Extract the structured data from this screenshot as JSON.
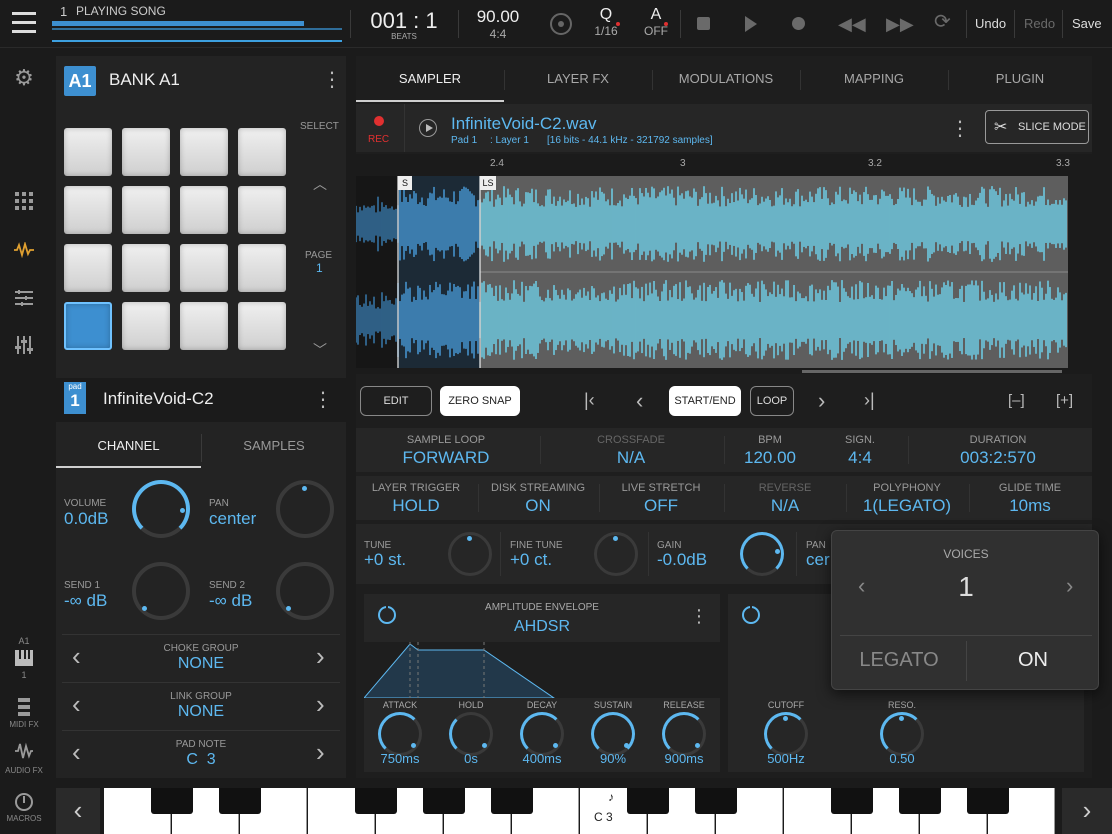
{
  "topbar": {
    "song_number": "1",
    "song_label": "PLAYING SONG",
    "position": "001 : 1",
    "position_unit": "BEATS",
    "tempo": "90.00",
    "signature": "4:4",
    "quantize_label": "Q",
    "quantize_value": "1/16",
    "auto_label": "A",
    "auto_value": "OFF",
    "undo": "Undo",
    "redo": "Redo",
    "save": "Save"
  },
  "leftnav": {
    "bank_small": "A1",
    "bank_small_num": "1",
    "midi_fx": "MIDI FX",
    "audio_fx": "AUDIO FX",
    "macros": "MACROS"
  },
  "bank": {
    "badge": "A1",
    "title": "BANK A1",
    "select_label": "SELECT",
    "page_label": "PAGE",
    "page_value": "1",
    "selected_pad_index": 12
  },
  "pad": {
    "badge_label": "pad",
    "badge_num": "1",
    "name": "InfiniteVoid-C2"
  },
  "pad_tabs": [
    "CHANNEL",
    "SAMPLES"
  ],
  "channel": {
    "volume_label": "VOLUME",
    "volume_value": "0.0dB",
    "pan_label": "PAN",
    "pan_value": "center",
    "send1_label": "SEND 1",
    "send1_value": "-∞ dB",
    "send2_label": "SEND 2",
    "send2_value": "-∞ dB",
    "choke_label": "CHOKE GROUP",
    "choke_value": "NONE",
    "link_label": "LINK GROUP",
    "link_value": "NONE",
    "note_label": "PAD NOTE",
    "note_value": "C  3"
  },
  "main_tabs": [
    "SAMPLER",
    "LAYER FX",
    "MODULATIONS",
    "MAPPING",
    "PLUGIN"
  ],
  "sample": {
    "rec_label": "REC",
    "filename": "InfiniteVoid-C2.wav",
    "pad_ref": "Pad 1",
    "layer_ref": ": Layer 1",
    "info": "[16 bits - 44.1 kHz - 321792 samples]",
    "slice_mode": "SLICE MODE",
    "ruler": [
      "2.4",
      "3",
      "3.2",
      "3.3"
    ],
    "marker_s": "S",
    "marker_ls": "LS"
  },
  "editbar": {
    "edit": "EDIT",
    "zero_snap": "ZERO SNAP",
    "start_end": "START/END",
    "loop": "LOOP",
    "zoom_out": "[–]",
    "zoom_in": "[+]"
  },
  "params1": [
    {
      "label": "SAMPLE LOOP",
      "value": "FORWARD"
    },
    {
      "label": "CROSSFADE",
      "value": "N/A"
    },
    {
      "label": "BPM",
      "value": "120.00"
    },
    {
      "label": "SIGN.",
      "value": "4:4"
    },
    {
      "label": "DURATION",
      "value": "003:2:570"
    }
  ],
  "params2": [
    {
      "label": "LAYER TRIGGER",
      "value": "HOLD"
    },
    {
      "label": "DISK STREAMING",
      "value": "ON"
    },
    {
      "label": "LIVE STRETCH",
      "value": "OFF"
    },
    {
      "label": "REVERSE",
      "value": "N/A"
    },
    {
      "label": "POLYPHONY",
      "value": "1(LEGATO)"
    },
    {
      "label": "GLIDE TIME",
      "value": "10ms"
    }
  ],
  "tuning": [
    {
      "label": "TUNE",
      "value": "+0 st."
    },
    {
      "label": "FINE TUNE",
      "value": "+0 ct."
    },
    {
      "label": "GAIN",
      "value": "-0.0dB"
    },
    {
      "label": "PAN",
      "value": "cer"
    }
  ],
  "envelope": {
    "title": "AMPLITUDE ENVELOPE",
    "type": "AHDSR",
    "knobs": [
      {
        "label": "ATTACK",
        "value": "750ms"
      },
      {
        "label": "HOLD",
        "value": "0s"
      },
      {
        "label": "DECAY",
        "value": "400ms"
      },
      {
        "label": "SUSTAIN",
        "value": "90%"
      },
      {
        "label": "RELEASE",
        "value": "900ms"
      }
    ]
  },
  "filter": {
    "knobs": [
      {
        "label": "CUTOFF",
        "value": "500Hz"
      },
      {
        "label": "RESO.",
        "value": "0.50"
      }
    ]
  },
  "voices_popup": {
    "title": "VOICES",
    "value": "1",
    "legato_label": "LEGATO",
    "legato_value": "ON"
  },
  "keyboard": {
    "note_glyph": "♪",
    "label": "C 3"
  },
  "colors": {
    "accent": "#5db8f0",
    "waveform": "#6fd8f2",
    "rec": "#e03030",
    "selected_pad": "#3d8fd0"
  }
}
